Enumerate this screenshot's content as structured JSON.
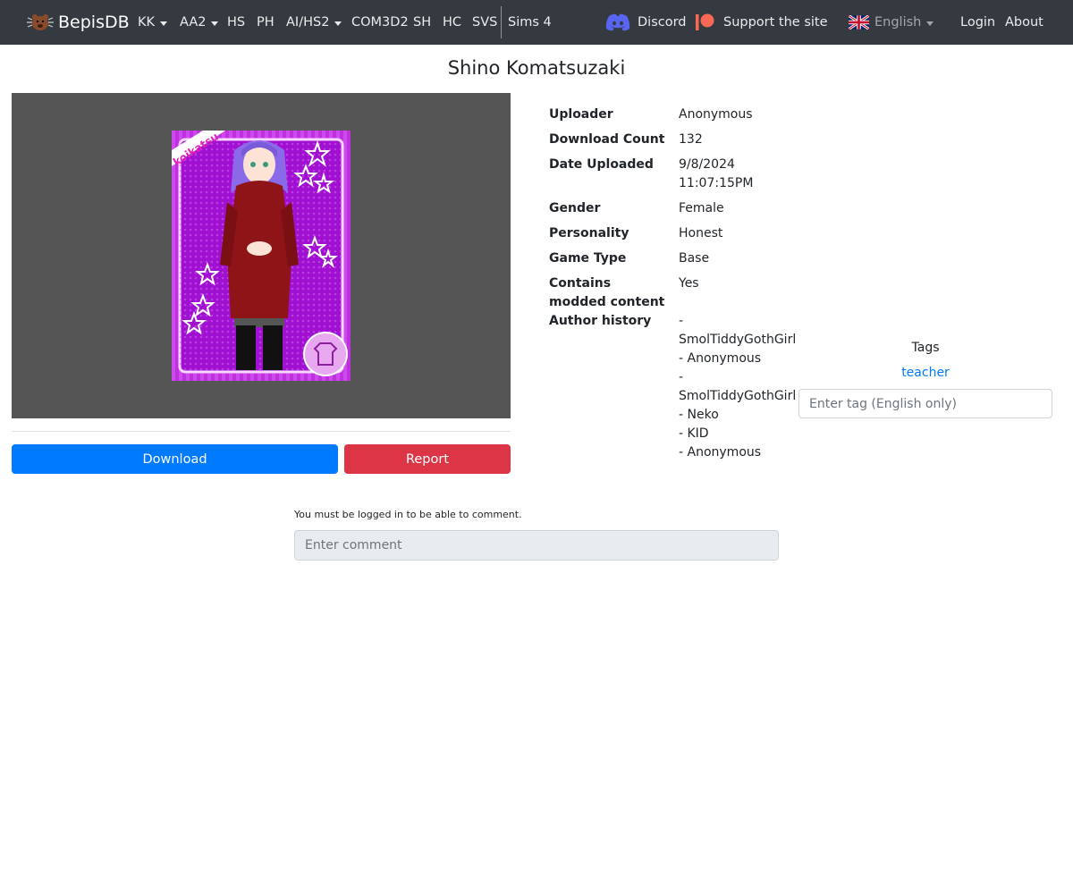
{
  "navbar": {
    "brand": "BepisDB",
    "items": [
      {
        "label": "KK",
        "dropdown": true
      },
      {
        "label": "AA2",
        "dropdown": true
      },
      {
        "label": "HS",
        "dropdown": false
      },
      {
        "label": "PH",
        "dropdown": false
      },
      {
        "label": "AI/HS2",
        "dropdown": true
      },
      {
        "label": "COM3D2",
        "dropdown": false
      },
      {
        "label": "SH",
        "dropdown": false
      },
      {
        "label": "HC",
        "dropdown": false
      },
      {
        "label": "SVS",
        "dropdown": false
      },
      {
        "label": "Sims 4",
        "dropdown": false
      }
    ],
    "discord": "Discord",
    "support": "Support the site",
    "language": "English",
    "login": "Login",
    "about": "About",
    "colors": {
      "background": "#343a40",
      "discord": "#5865f2",
      "patreon": "#f96854"
    }
  },
  "card": {
    "title": "Shino Komatsuzaki",
    "image_label": "koikatsu",
    "download": "Download",
    "report": "Report",
    "colors": {
      "download": "#007bff",
      "report": "#dc3545",
      "card_bg": "#b000d8"
    }
  },
  "info": {
    "uploader": {
      "label": "Uploader",
      "value": "Anonymous"
    },
    "download_count": {
      "label": "Download Count",
      "value": "132"
    },
    "date_uploaded": {
      "label": "Date Uploaded",
      "value_line1": "9/8/2024",
      "value_line2": "11:07:15PM"
    },
    "gender": {
      "label": "Gender",
      "value": "Female"
    },
    "personality": {
      "label": "Personality",
      "value": "Honest"
    },
    "game_type": {
      "label": "Game Type",
      "value": "Base"
    },
    "modded": {
      "label_line1": "Contains",
      "label_line2": "modded content",
      "value": "Yes"
    },
    "author_history": {
      "label": "Author history",
      "lines": [
        "-",
        "SmolTiddyGothGirl",
        "- Anonymous",
        "-",
        "SmolTiddyGothGirl",
        "- Neko",
        "- KID",
        "- Anonymous"
      ]
    }
  },
  "tags": {
    "heading": "Tags",
    "items": [
      "teacher"
    ],
    "input_placeholder": "Enter tag (English only)"
  },
  "comments": {
    "login_note": "You must be logged in to be able to comment.",
    "input_placeholder": "Enter comment"
  }
}
